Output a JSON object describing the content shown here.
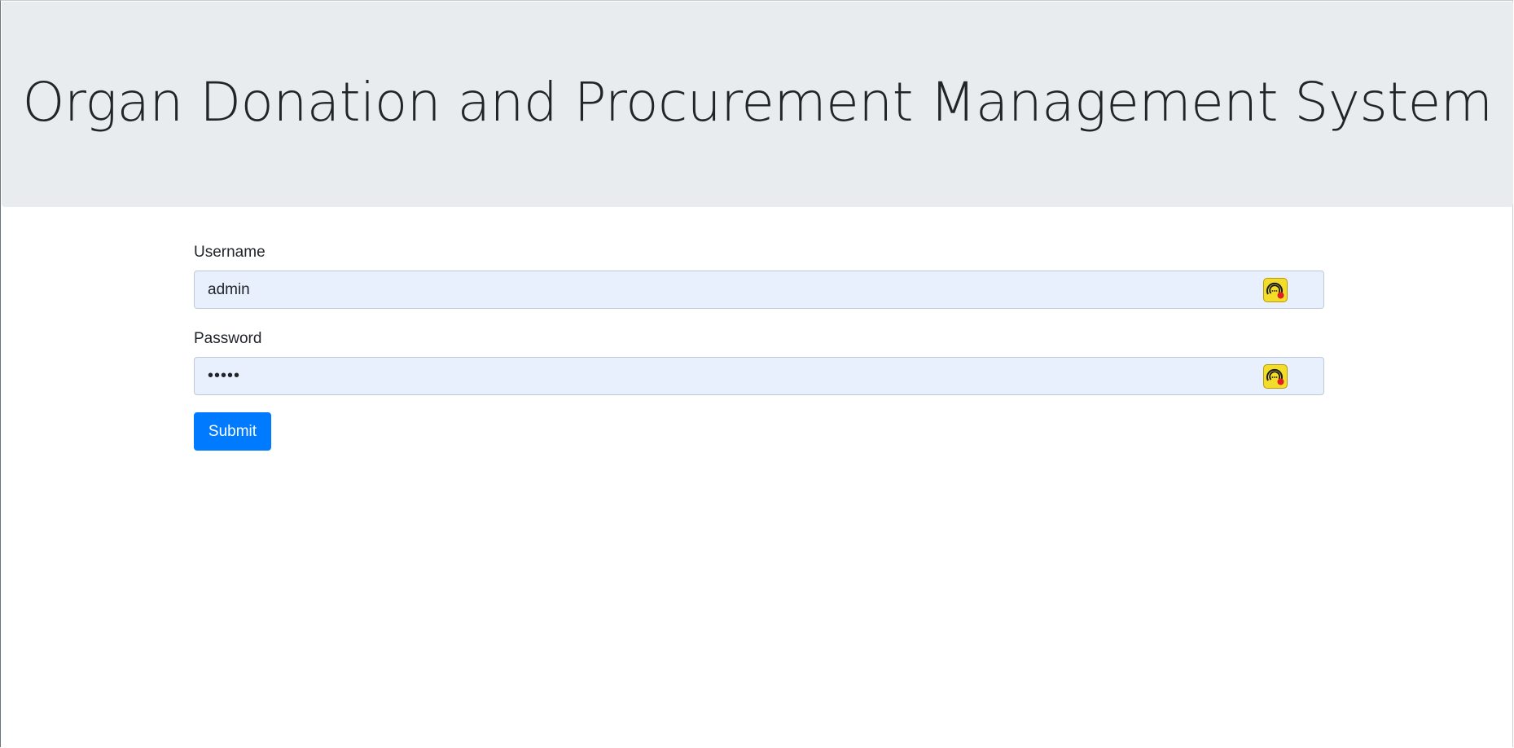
{
  "header": {
    "title": "Organ Donation and Procurement Management System"
  },
  "form": {
    "username": {
      "label": "Username",
      "value": "admin",
      "icon": "password-manager-extension-icon"
    },
    "password": {
      "label": "Password",
      "value": "•••••",
      "icon": "password-manager-extension-icon"
    },
    "submit_label": "Submit"
  },
  "colors": {
    "header_background": "#e9ecef",
    "autofill_background": "#e8f0fe",
    "button_primary": "#007bff",
    "extension_icon": "#f4dc2a"
  }
}
